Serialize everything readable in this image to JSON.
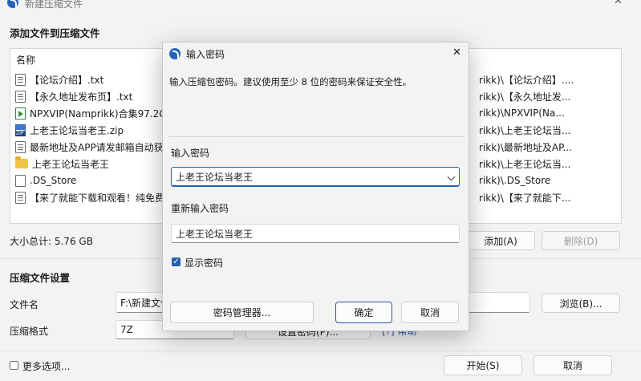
{
  "window": {
    "title": "新建压缩文件",
    "close_glyph": "✕"
  },
  "main": {
    "add_files_heading": "添加文件到压缩文件",
    "list_header_name": "名称",
    "files": [
      {
        "icon": "text-file-icon",
        "kind": "txt",
        "name": "【论坛介绍】.txt",
        "path": "rikk)\\【论坛介绍】...."
      },
      {
        "icon": "text-file-icon",
        "kind": "txt",
        "name": "【永久地址发布页】.txt",
        "path": "rikk)\\【永久地址发..."
      },
      {
        "icon": "video-file-icon",
        "kind": "video",
        "name": "NPXVIP(Namprikk)合集97.2G",
        "path": "rikk)\\NPXVIP(Na..."
      },
      {
        "icon": "zip-file-icon",
        "kind": "zip",
        "name": "上老王论坛当老王.zip",
        "path": "rikk)\\上老王论坛当..."
      },
      {
        "icon": "text-file-icon",
        "kind": "txt",
        "name": "最新地址及APP请发邮箱自动获",
        "path": "rikk)\\最新地址及AP..."
      },
      {
        "icon": "folder-icon",
        "kind": "folder",
        "name": "上老王论坛当老王",
        "path": "rikk)\\上老王论坛当..."
      },
      {
        "icon": "file-icon",
        "kind": "plain",
        "name": ".DS_Store",
        "path": "rikk)\\.DS_Store"
      },
      {
        "icon": "text-file-icon",
        "kind": "txt",
        "name": "【来了就能下载和观看！纯免费",
        "path": "rikk)\\【来了就能下..."
      }
    ],
    "total_size": "大小总计: 5.76 GB",
    "add_button": "添加(A)",
    "delete_button": "删除(D)",
    "settings_heading": "压缩文件设置",
    "filename_label": "文件名",
    "filename_value": "F:\\新建文件",
    "browse_button": "浏览(B)...",
    "format_label": "压缩格式",
    "format_value": "7Z",
    "hidden_button_fragment": "设置密码(P)...",
    "hidden_link_fragment": "[?] 帮助",
    "more_options": "更多选项...",
    "start_button": "开始(S)",
    "cancel_button": "取消"
  },
  "dialog": {
    "title": "输入密码",
    "close_glyph": "✕",
    "instruction": "输入压缩包密码。建议使用至少 8 位的密码来保证安全性。",
    "password_label": "输入密码",
    "password_value": "上老王论坛当老王",
    "repeat_label": "重新输入密码",
    "repeat_value": "上老王论坛当老王",
    "show_password_label": "显示密码",
    "show_password_checked": true,
    "password_manager_button": "密码管理器...",
    "ok_button": "确定",
    "cancel_button": "取消"
  },
  "colors": {
    "accent": "#2560b0",
    "window_bg": "#f3f3f3"
  }
}
